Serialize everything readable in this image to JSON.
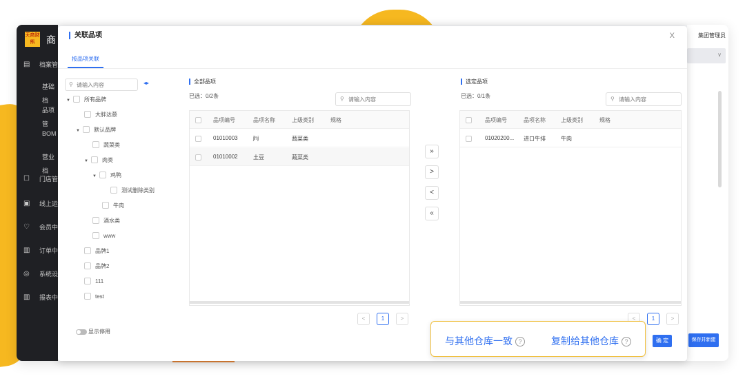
{
  "app": {
    "title": "商",
    "logo_text": "天商财熊",
    "admin_label": "集团管理员",
    "save_new_label": "保存并新建",
    "right_select_caret": "∨"
  },
  "sidebar": {
    "items": [
      {
        "icon": "▤",
        "label": "档案管"
      },
      {
        "icon": "",
        "label": "基础档"
      },
      {
        "icon": "",
        "label": "品项管"
      },
      {
        "icon": "",
        "label": "BOM"
      },
      {
        "icon": "",
        "label": "营业档"
      },
      {
        "icon": "☐",
        "label": "门店管"
      },
      {
        "icon": "▣",
        "label": "线上运"
      },
      {
        "icon": "♡",
        "label": "会员中"
      },
      {
        "icon": "▥",
        "label": "订单中"
      },
      {
        "icon": "◎",
        "label": "系统设"
      },
      {
        "icon": "▥",
        "label": "报表中"
      }
    ]
  },
  "modal": {
    "title": "关联品项",
    "close": "X",
    "tab": "按品项关联",
    "tree": {
      "search_placeholder": "请输入内容",
      "toggle": "◂▸",
      "nodes": [
        {
          "label": "所有品牌",
          "caret": "▼"
        },
        {
          "label": "大胖达慕",
          "caret": ""
        },
        {
          "label": "默认品牌",
          "caret": "▼"
        },
        {
          "label": "蔬菜类",
          "caret": ""
        },
        {
          "label": "肉类",
          "caret": "▼"
        },
        {
          "label": "鸡鸭",
          "caret": "▼"
        },
        {
          "label": "测试删除类别",
          "caret": ""
        },
        {
          "label": "牛肉",
          "caret": ""
        },
        {
          "label": "酒水类",
          "caret": ""
        },
        {
          "label": "www",
          "caret": ""
        },
        {
          "label": "品牌1",
          "caret": ""
        },
        {
          "label": "品牌2",
          "caret": ""
        },
        {
          "label": "111",
          "caret": ""
        },
        {
          "label": "test",
          "caret": ""
        }
      ],
      "switch_label": "显示停用"
    },
    "left_panel": {
      "title": "全部品项",
      "count": "已选：0/2条",
      "search_placeholder": "请输入内容",
      "columns": [
        "品项编号",
        "品项名称",
        "上级类别",
        "规格"
      ],
      "rows": [
        {
          "code": "01010003",
          "name": "jhj",
          "category": "蔬菜类",
          "spec": ""
        },
        {
          "code": "01010002",
          "name": "土豆",
          "category": "蔬菜类",
          "spec": ""
        }
      ],
      "page": "1"
    },
    "transfer": {
      "all_right": "»",
      "right": ">",
      "left": "<",
      "all_left": "«"
    },
    "right_panel": {
      "title": "选定品项",
      "count": "已选：0/1条",
      "search_placeholder": "请输入内容",
      "columns": [
        "品项编号",
        "品项名称",
        "上级类别",
        "规格"
      ],
      "rows": [
        {
          "code": "01020200...",
          "name": "进口牛排",
          "category": "牛肉",
          "spec": ""
        }
      ],
      "page": "1"
    },
    "pager": {
      "prev": "<",
      "next": ">"
    },
    "callout": {
      "option1": "与其他仓库一致",
      "option2": "复制给其他仓库",
      "help": "?"
    },
    "confirm_label": "确 定"
  }
}
